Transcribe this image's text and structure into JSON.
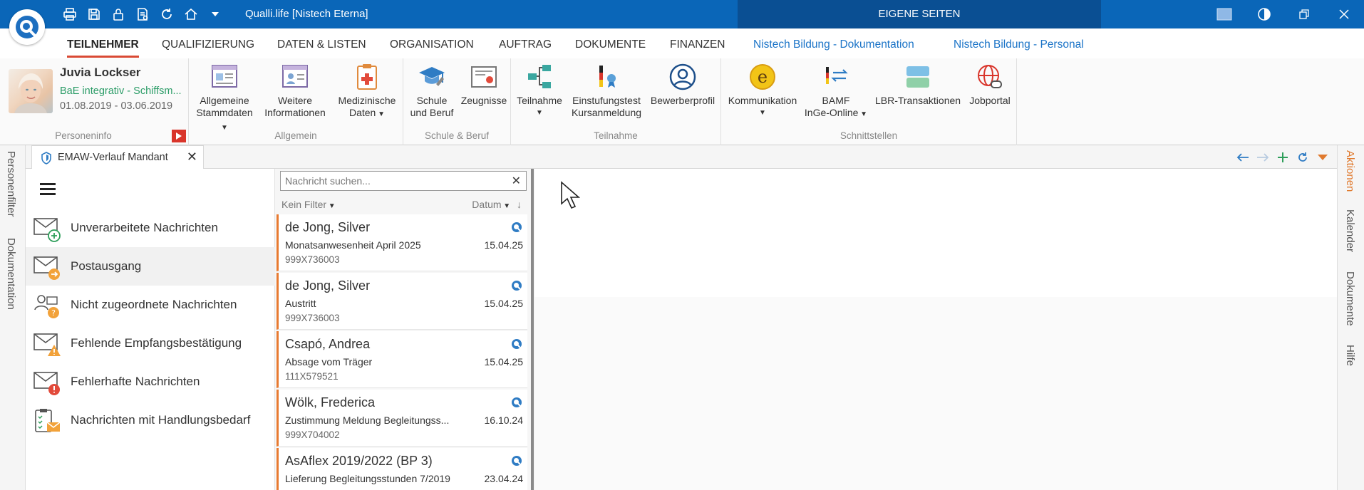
{
  "titlebar": {
    "window_title": "Qualli.life [Nistech Eterna]",
    "eigene_label": "EIGENE SEITEN",
    "colors": {
      "bar": "#0a66b8",
      "eigene": "#0a4f93"
    },
    "quick_access_icons": [
      "printer-icon",
      "save-icon",
      "lock-icon",
      "document-settings-icon",
      "refresh-icon",
      "home-icon",
      "dropdown-icon"
    ],
    "window_controls": [
      "layout-icon",
      "contrast-icon",
      "restore-icon",
      "close-icon"
    ]
  },
  "menu": {
    "tabs": [
      {
        "label": "TEILNEHMER",
        "active": true
      },
      {
        "label": "QUALIFIZIERUNG"
      },
      {
        "label": "DATEN & LISTEN"
      },
      {
        "label": "ORGANISATION"
      },
      {
        "label": "AUFTRAG"
      },
      {
        "label": "DOKUMENTE"
      },
      {
        "label": "FINANZEN"
      },
      {
        "label": "Nistech Bildung - Dokumentation"
      },
      {
        "label": "Nistech Bildung - Personal"
      }
    ],
    "accent": "#d94a34",
    "special_color": "#1a73c7"
  },
  "person": {
    "name": "Juvia Lockser",
    "org": "BaE integrativ - Schiffsm...",
    "dates": "01.08.2019 - 03.06.2019",
    "group_label": "Personeninfo"
  },
  "ribbon": {
    "groups": {
      "allgemein": "Allgemein",
      "schule": "Schule & Beruf",
      "teilnahme": "Teilnahme",
      "schnittstellen": "Schnittstellen"
    },
    "buttons": {
      "stammdaten_1": "Allgemeine",
      "stammdaten_2": "Stammdaten",
      "weitere_1": "Weitere",
      "weitere_2": "Informationen",
      "med_1": "Medizinische",
      "med_2": "Daten",
      "schule_1": "Schule",
      "schule_2": "und Beruf",
      "zeugnisse": "Zeugnisse",
      "teilnahme": "Teilnahme",
      "einstufung_1": "Einstufungstest",
      "einstufung_2": "Kursanmeldung",
      "bewerber": "Bewerberprofil",
      "kommunikation": "Kommunikation",
      "bamf_1": "BAMF",
      "bamf_2": "InGe-Online",
      "lbr": "LBR-Transaktionen",
      "jobportal": "Jobportal"
    }
  },
  "sidebars": {
    "left": [
      "Personenfilter",
      "Dokumentation"
    ],
    "right": [
      "Aktionen",
      "Kalender",
      "Dokumente",
      "Hilfe"
    ],
    "active_color": "#e07a2e"
  },
  "doc_tab": {
    "label": "EMAW-Verlauf Mandant"
  },
  "folders": [
    {
      "label": "Unverarbeitete Nachrichten",
      "icon": "mail-add-icon"
    },
    {
      "label": "Postausgang",
      "icon": "mail-outbox-icon",
      "selected": true
    },
    {
      "label": "Nicht zugeordnete Nachrichten",
      "icon": "unassigned-contacts-icon"
    },
    {
      "label": "Fehlende Empfangsbestätigung",
      "icon": "mail-warning-icon"
    },
    {
      "label": "Fehlerhafte Nachrichten",
      "icon": "mail-error-icon"
    },
    {
      "label": "Nachrichten mit Handlungsbedarf",
      "icon": "mail-checklist-icon"
    }
  ],
  "list": {
    "search_placeholder": "Nachricht suchen...",
    "filter_label": "Kein Filter",
    "sort_label": "Datum",
    "messages": [
      {
        "name": "de Jong, Silver",
        "subject": "Monatsanwesenheit April 2025",
        "id": "999X736003",
        "date": "15.04.25"
      },
      {
        "name": "de Jong, Silver",
        "subject": "Austritt",
        "id": "999X736003",
        "date": "15.04.25"
      },
      {
        "name": "Csapó, Andrea",
        "subject": "Absage vom Träger",
        "id": "111X579521",
        "date": "15.04.25"
      },
      {
        "name": "Wölk, Frederica",
        "subject": "Zustimmung Meldung Begleitungss...",
        "id": "999X704002",
        "date": "16.10.24"
      },
      {
        "name": "AsAflex 2019/2022 (BP 3)",
        "subject": "Lieferung Begleitungsstunden 7/2019",
        "id": "",
        "date": "23.04.24"
      }
    ],
    "accent": "#e87a30"
  }
}
